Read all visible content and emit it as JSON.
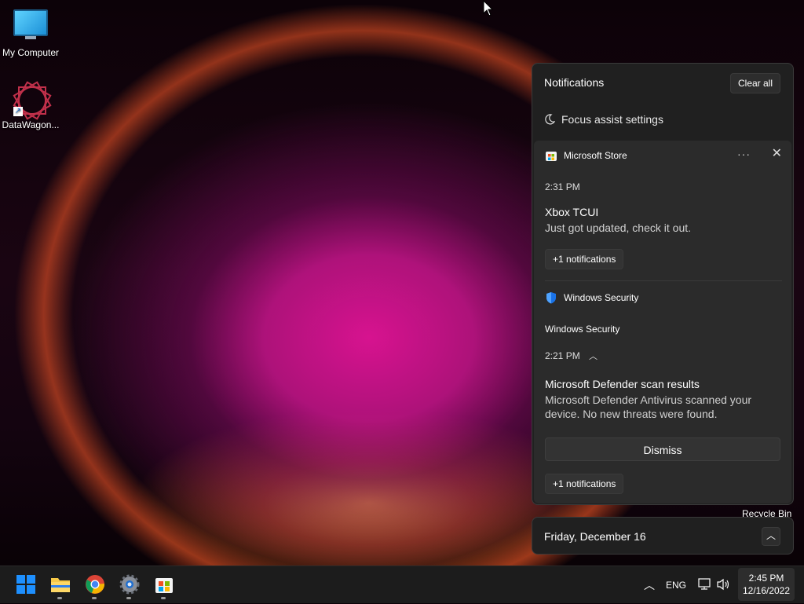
{
  "desktop": {
    "icons": [
      {
        "label": "My Computer",
        "icon": "monitor-icon"
      },
      {
        "label": "DataWagon...",
        "icon": "datawagon-icon"
      }
    ],
    "recycle_bin_label": "Recycle Bin"
  },
  "notification_center": {
    "title": "Notifications",
    "clear_all": "Clear all",
    "focus_assist": "Focus assist settings",
    "groups": [
      {
        "app": "Microsoft Store",
        "time": "2:31 PM",
        "title": "Xbox TCUI",
        "body": "Just got updated, check it out.",
        "more": "+1 notifications"
      },
      {
        "app": "Windows Security",
        "subheader": "Windows Security",
        "time": "2:21 PM",
        "title": "Microsoft Defender scan results",
        "body": "Microsoft Defender Antivirus scanned your device. No new threats were found.",
        "action": "Dismiss",
        "more": "+1 notifications"
      }
    ]
  },
  "calendar": {
    "date": "Friday, December 16"
  },
  "taskbar": {
    "apps": [
      "start-icon",
      "file-explorer-icon",
      "chrome-icon",
      "settings-icon",
      "store-icon"
    ],
    "language": "ENG",
    "clock_time": "2:45 PM",
    "clock_date": "12/16/2022"
  },
  "colors": {
    "accent": "#0078d4",
    "panel_bg": "#202020",
    "card_bg": "#2b2b2b"
  }
}
